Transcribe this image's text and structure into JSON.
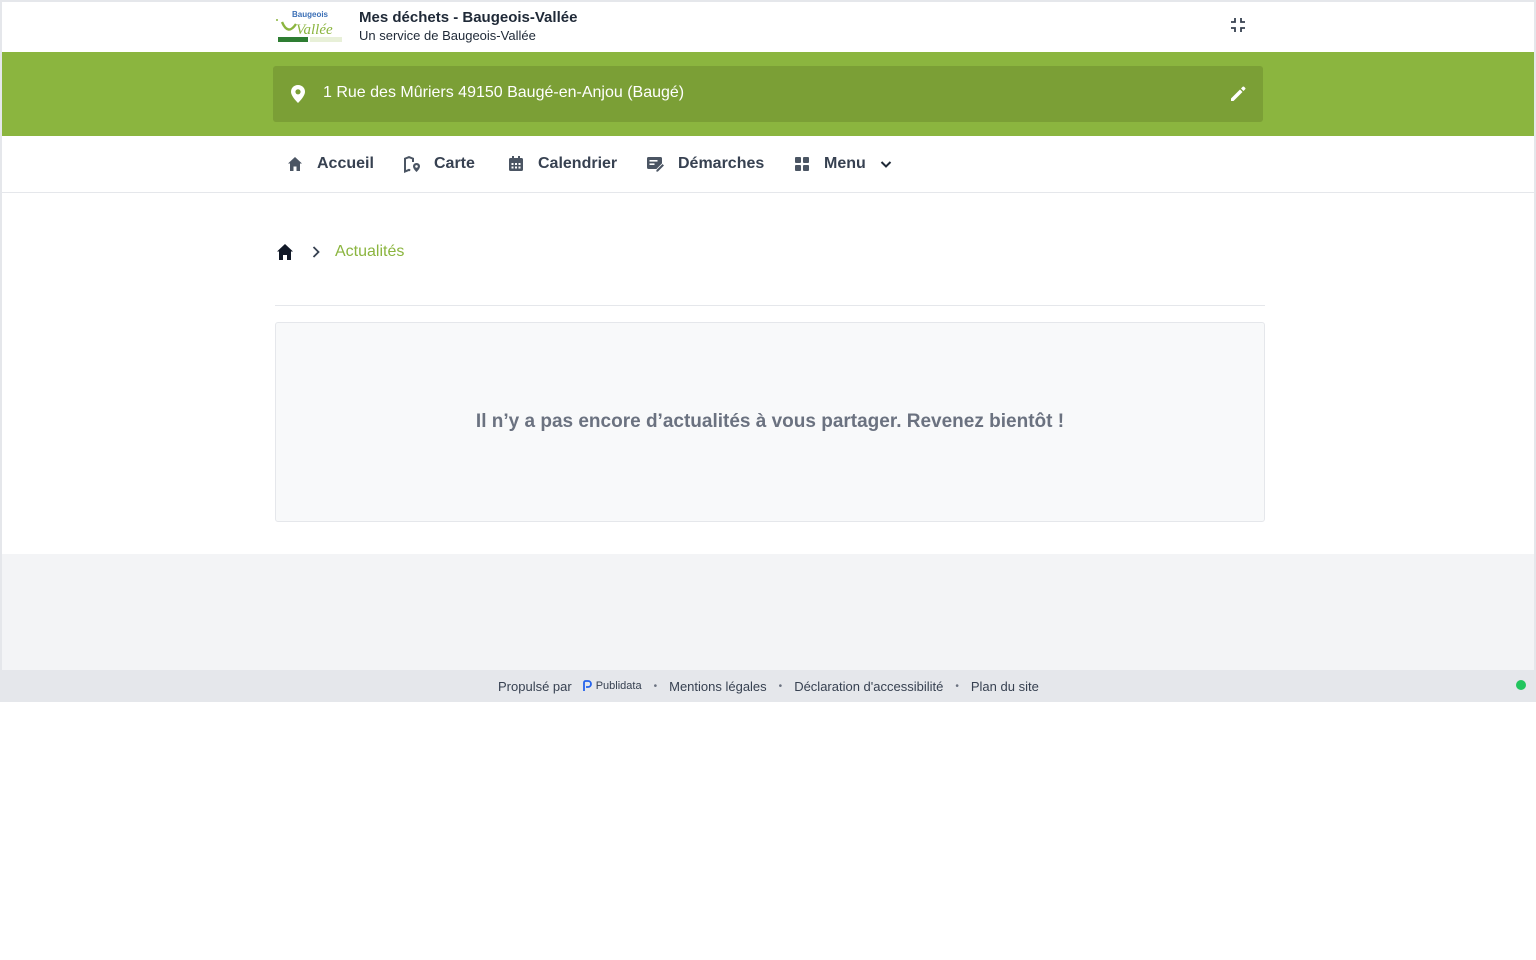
{
  "header": {
    "logo_alt": "Baugeois Vallée",
    "title": "Mes déchets - Baugeois-Vallée",
    "subtitle": "Un service de Baugeois-Vallée",
    "collapse_icon": "collapse-icon"
  },
  "address": {
    "icon": "map-pin-icon",
    "text": "1 Rue des Mûriers 49150 Baugé-en-Anjou (Baugé)",
    "edit_icon": "pencil-icon"
  },
  "nav": {
    "items": [
      {
        "label": "Accueil",
        "icon": "home-icon"
      },
      {
        "label": "Carte",
        "icon": "map-icon"
      },
      {
        "label": "Calendrier",
        "icon": "calendar-icon"
      },
      {
        "label": "Démarches",
        "icon": "form-edit-icon"
      },
      {
        "label": "Menu",
        "icon": "grid-icon"
      }
    ]
  },
  "breadcrumb": {
    "home_icon": "home-icon",
    "current": "Actualités"
  },
  "main": {
    "empty_message": "Il n’y a pas encore d’actualités à vous partager. Revenez bientôt !"
  },
  "footer": {
    "powered_by": "Propulsé par",
    "provider": "Publidata",
    "links": [
      "Mentions légales",
      "Déclaration d'accessibilité",
      "Plan du site"
    ],
    "separator": "•"
  },
  "colors": {
    "brand_green": "#8bb53f",
    "address_box": "#7b9f36",
    "status_online": "#22c55e"
  }
}
